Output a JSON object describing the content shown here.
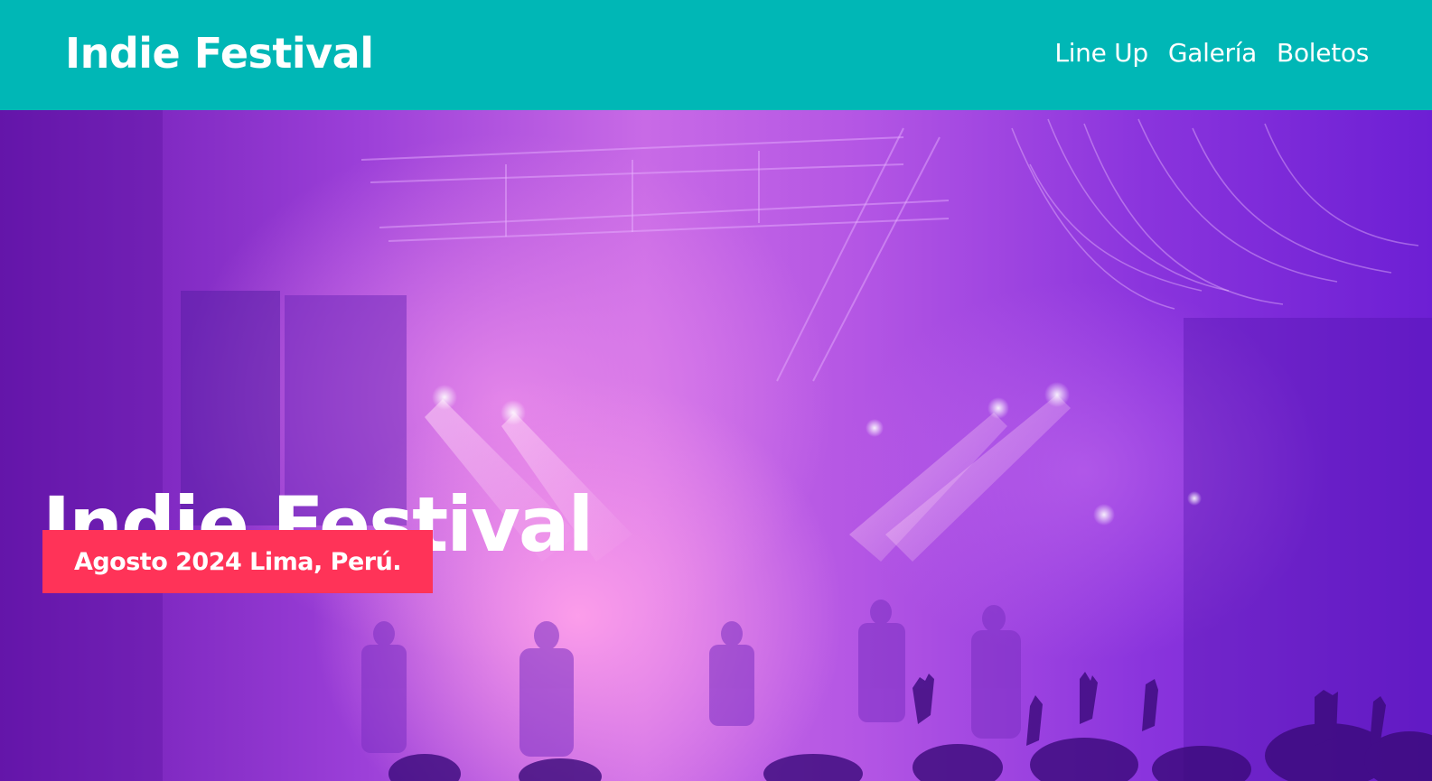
{
  "header": {
    "brand": "Indie Festival",
    "nav": [
      {
        "label": "Line Up"
      },
      {
        "label": "Galería"
      },
      {
        "label": "Boletos"
      }
    ],
    "background_color": "#00b7b6"
  },
  "hero": {
    "title": "Indie Festival",
    "badge": "Agosto 2024 Lima, Perú.",
    "badge_color": "#ff3358",
    "image_description_icon": "concert-stage-photo"
  }
}
